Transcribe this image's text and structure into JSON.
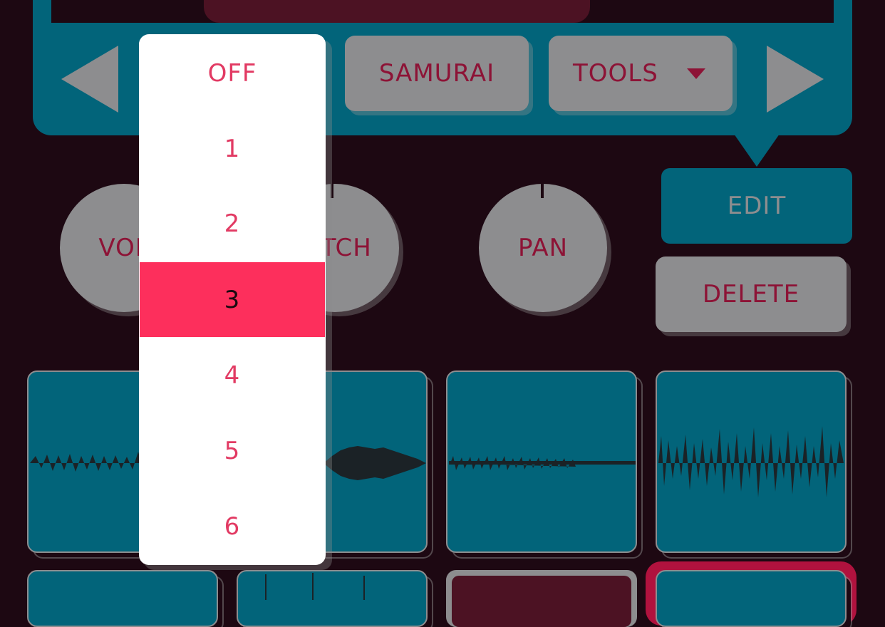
{
  "nav": {
    "prev_icon": "left-triangle-icon",
    "next_icon": "right-triangle-icon",
    "samurai_label": "SAMURAI",
    "tools_label": "TOOLS",
    "tools_caret_icon": "caret-down-icon"
  },
  "knobs": {
    "vol_label": "VOL",
    "pitch_label": "PITCH",
    "pan_label": "PAN"
  },
  "actions": {
    "edit_label": "EDIT",
    "delete_label": "DELETE"
  },
  "dropdown": {
    "options": [
      "OFF",
      "1",
      "2",
      "3",
      "4",
      "5",
      "6"
    ],
    "selected": "3"
  },
  "colors": {
    "background": "#1d0812",
    "teal": "#02647a",
    "gray": "#8d8d8f",
    "crimson": "#8d1336",
    "highlight": "#fd2f5c"
  }
}
